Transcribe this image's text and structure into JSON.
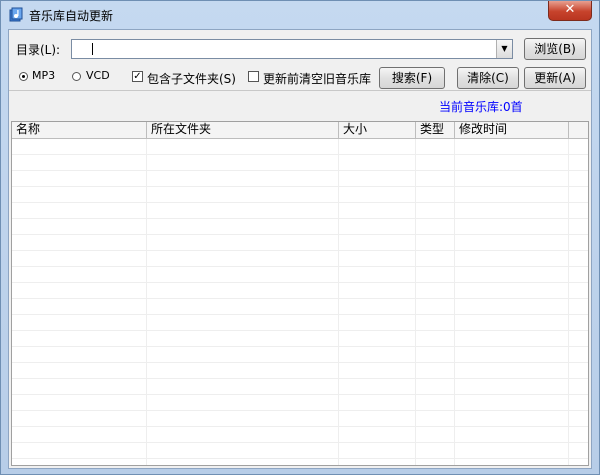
{
  "window": {
    "title": "音乐库自动更新",
    "close_glyph": "✕"
  },
  "form": {
    "dir_label": "目录(L):",
    "dir_value": "",
    "browse_label": "浏览(B)",
    "radio_mp3_label": "MP3",
    "radio_vcd_label": "VCD",
    "radio_selected": "MP3",
    "include_subfolders_label": "包含子文件夹(S)",
    "include_subfolders_checked": true,
    "clear_before_update_label": "更新前清空旧音乐库",
    "clear_before_update_checked": false,
    "search_label": "搜索(F)",
    "clear_label": "清除(C)",
    "update_label": "更新(A)"
  },
  "status": {
    "library_count": "当前音乐库:0首"
  },
  "table": {
    "columns": [
      "名称",
      "所在文件夹",
      "大小",
      "类型",
      "修改时间"
    ],
    "rows": []
  },
  "icons": {
    "app": "music-library-icon",
    "dropdown": "chevron-down-icon",
    "close": "close-icon"
  },
  "colors": {
    "status_text": "#0000ff",
    "close_button": "#c7432c",
    "frame": "#c5d9f0"
  }
}
